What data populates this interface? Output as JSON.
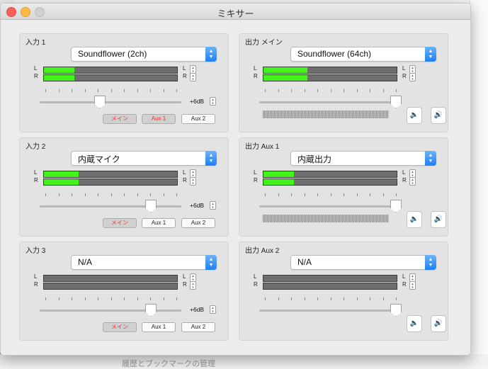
{
  "window": {
    "title": "ミキサー"
  },
  "background": {
    "footer_text": "履歴とブックマークの管理"
  },
  "inputs": [
    {
      "title": "入力 1",
      "source": "Soundflower (2ch)",
      "meter_l_label": "L",
      "meter_r_label": "R",
      "level_l": 0.23,
      "level_r": 0.23,
      "gain_label": "+6dB",
      "fader_level": 0.42,
      "routes": [
        {
          "label": "メイン",
          "active": true,
          "red": true
        },
        {
          "label": "Aux 1",
          "active": true,
          "red": true
        },
        {
          "label": "Aux 2",
          "active": false,
          "red": false
        }
      ]
    },
    {
      "title": "入力 2",
      "source": "内蔵マイク",
      "meter_l_label": "L",
      "meter_r_label": "R",
      "level_l": 0.26,
      "level_r": 0.26,
      "gain_label": "+6dB",
      "fader_level": 0.78,
      "routes": [
        {
          "label": "メイン",
          "active": true,
          "red": true
        },
        {
          "label": "Aux 1",
          "active": false,
          "red": false
        },
        {
          "label": "Aux 2",
          "active": false,
          "red": false
        }
      ]
    },
    {
      "title": "入力 3",
      "source": "N/A",
      "meter_l_label": "L",
      "meter_r_label": "R",
      "level_l": 0.0,
      "level_r": 0.0,
      "gain_label": "+6dB",
      "fader_level": 0.78,
      "routes": [
        {
          "label": "メイン",
          "active": true,
          "red": true
        },
        {
          "label": "Aux 1",
          "active": false,
          "red": false
        },
        {
          "label": "Aux 2",
          "active": false,
          "red": false
        }
      ]
    }
  ],
  "outputs": [
    {
      "title": "出力 メイン",
      "device": "Soundflower (64ch)",
      "meter_l_label": "L",
      "meter_r_label": "R",
      "level_l": 0.33,
      "level_r": 0.33,
      "fader_level": 0.96,
      "volume_down_icon": "speaker-low-icon",
      "volume_up_icon": "speaker-high-icon",
      "volume_down_glyph": "🔈",
      "volume_up_glyph": "🔊"
    },
    {
      "title": "出力 Aux 1",
      "device": "内蔵出力",
      "meter_l_label": "L",
      "meter_r_label": "R",
      "level_l": 0.23,
      "level_r": 0.23,
      "fader_level": 0.96,
      "volume_down_icon": "speaker-low-icon",
      "volume_up_icon": "speaker-high-icon",
      "volume_down_glyph": "🔈",
      "volume_up_glyph": "🔊"
    },
    {
      "title": "出力 Aux 2",
      "device": "N/A",
      "meter_l_label": "L",
      "meter_r_label": "R",
      "level_l": 0.0,
      "level_r": 0.0,
      "fader_level": 0.96,
      "volume_down_icon": "speaker-low-icon",
      "volume_up_icon": "speaker-high-icon",
      "volume_down_glyph": "🔈",
      "volume_up_glyph": "🔊"
    }
  ],
  "colors": {
    "meter_fill": "#43f31c",
    "route_active_text": "#ff2a2a",
    "select_accent": "#1d80f7"
  }
}
